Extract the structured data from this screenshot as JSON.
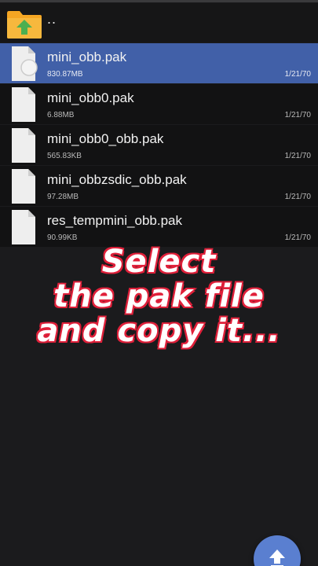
{
  "parent": {
    "label": ".."
  },
  "files": [
    {
      "name": "mini_obb.pak",
      "size": "830.87MB",
      "date": "1/21/70",
      "selected": true
    },
    {
      "name": "mini_obb0.pak",
      "size": "6.88MB",
      "date": "1/21/70",
      "selected": false
    },
    {
      "name": "mini_obb0_obb.pak",
      "size": "565.83KB",
      "date": "1/21/70",
      "selected": false
    },
    {
      "name": "mini_obbzsdic_obb.pak",
      "size": "97.28MB",
      "date": "1/21/70",
      "selected": false
    },
    {
      "name": "res_tempmini_obb.pak",
      "size": "90.99KB",
      "date": "1/21/70",
      "selected": false
    }
  ],
  "caption": {
    "line1": "Select",
    "line2": "the pak file",
    "line3": "and copy it..."
  },
  "colors": {
    "background": "#1b1b1d",
    "selected_row": "#4160a8",
    "caption_outline": "#e0203a",
    "fab": "#5a7fd0",
    "folder": "#f5a623",
    "up_arrow": "#4caf50"
  },
  "icons": {
    "parent": "folder-up-icon",
    "file": "file-icon",
    "fab": "upload-icon"
  }
}
